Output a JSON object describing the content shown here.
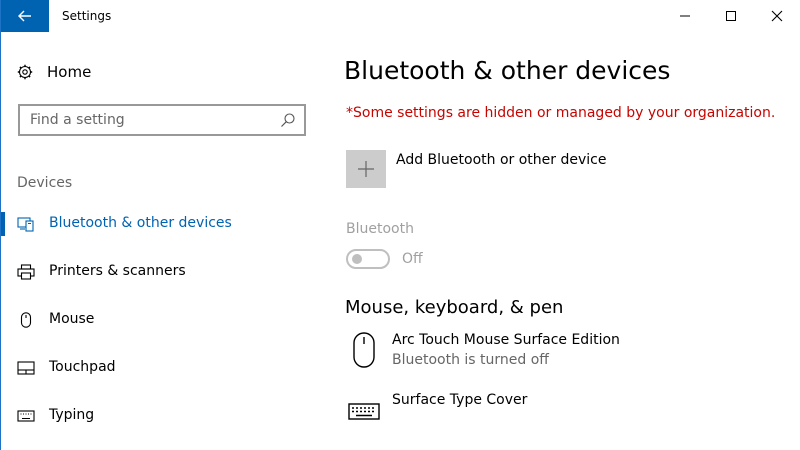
{
  "window": {
    "title": "Settings",
    "accent_color": "#0063b1",
    "warning_color": "#c50500"
  },
  "titlebar": {
    "back_icon": "back-arrow-icon",
    "minimize_icon": "minimize-icon",
    "maximize_icon": "maximize-icon",
    "close_icon": "close-icon"
  },
  "sidebar": {
    "home_label": "Home",
    "home_icon": "gear-icon",
    "search_placeholder": "Find a setting",
    "search_icon": "search-icon",
    "section_title": "Devices",
    "items": [
      {
        "label": "Bluetooth & other devices",
        "icon": "bluetooth-devices-icon",
        "selected": true
      },
      {
        "label": "Printers & scanners",
        "icon": "printer-icon",
        "selected": false
      },
      {
        "label": "Mouse",
        "icon": "mouse-icon",
        "selected": false
      },
      {
        "label": "Touchpad",
        "icon": "touchpad-icon",
        "selected": false
      },
      {
        "label": "Typing",
        "icon": "keyboard-icon",
        "selected": false
      }
    ]
  },
  "main": {
    "title": "Bluetooth & other devices",
    "warning": "*Some settings are hidden or managed by your organization.",
    "add_device_label": "Add Bluetooth or other device",
    "bluetooth_label": "Bluetooth",
    "bluetooth_state": "Off",
    "bluetooth_on": false,
    "section_heading": "Mouse, keyboard, & pen",
    "devices": [
      {
        "name": "Arc Touch Mouse Surface Edition",
        "status": "Bluetooth is turned off",
        "icon": "mouse-icon"
      },
      {
        "name": "Surface Type Cover",
        "status": "",
        "icon": "keyboard-icon"
      }
    ]
  }
}
